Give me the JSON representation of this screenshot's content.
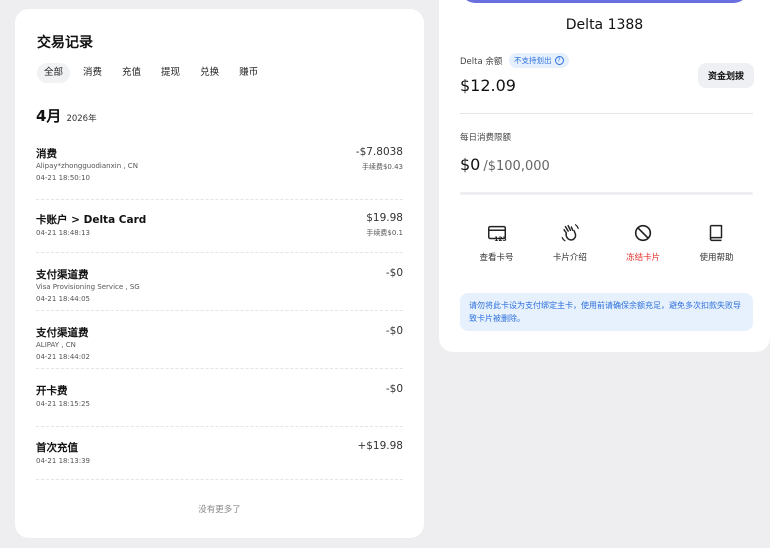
{
  "transactions": {
    "title": "交易记录",
    "filters": [
      "全部",
      "消费",
      "充值",
      "提现",
      "兑换",
      "赚币"
    ],
    "month": "4月",
    "year": "2026年",
    "items": [
      {
        "title": "消费",
        "subtitle": "Alipay*zhongguodianxin , CN",
        "date": "04-21 18:50:10",
        "amount": "-$7.8038",
        "fee": "手续费$0.43"
      },
      {
        "title": "卡账户 > Delta Card",
        "subtitle": "",
        "date": "04-21 18:48:13",
        "amount": "$19.98",
        "fee": "手续费$0.1"
      },
      {
        "title": "支付渠道费",
        "subtitle": "Visa Provisioning Service , SG",
        "date": "04-21 18:44:05",
        "amount": "-$0",
        "fee": ""
      },
      {
        "title": "支付渠道费",
        "subtitle": "ALIPAY , CN",
        "date": "04-21 18:44:02",
        "amount": "-$0",
        "fee": ""
      },
      {
        "title": "开卡费",
        "subtitle": "",
        "date": "04-21 18:15:25",
        "amount": "-$0",
        "fee": ""
      },
      {
        "title": "首次充值",
        "subtitle": "",
        "date": "04-21 18:13:39",
        "amount": "+$19.98",
        "fee": ""
      }
    ],
    "no_more": "没有更多了"
  },
  "card": {
    "accent_color": "#6a6fe0",
    "name": "Delta 1388",
    "balance_label": "Delta 余额",
    "balance_badge": "不支持划出",
    "balance_value": "$12.09",
    "transfer_button": "资金划拨",
    "limit_label": "每日消费限额",
    "limit_spent": "$0",
    "limit_max": "/$100,000",
    "limit_used_fraction": 0,
    "actions": [
      {
        "label": "查看卡号",
        "icon": "card-number-icon"
      },
      {
        "label": "卡片介绍",
        "icon": "hand-wave-icon"
      },
      {
        "label": "冻结卡片",
        "icon": "block-icon",
        "danger": true
      },
      {
        "label": "使用帮助",
        "icon": "book-icon"
      }
    ],
    "notice": "请勿将此卡设为支付绑定主卡，使用前请确保余额充足，避免多次扣款失败导致卡片被删除。"
  }
}
